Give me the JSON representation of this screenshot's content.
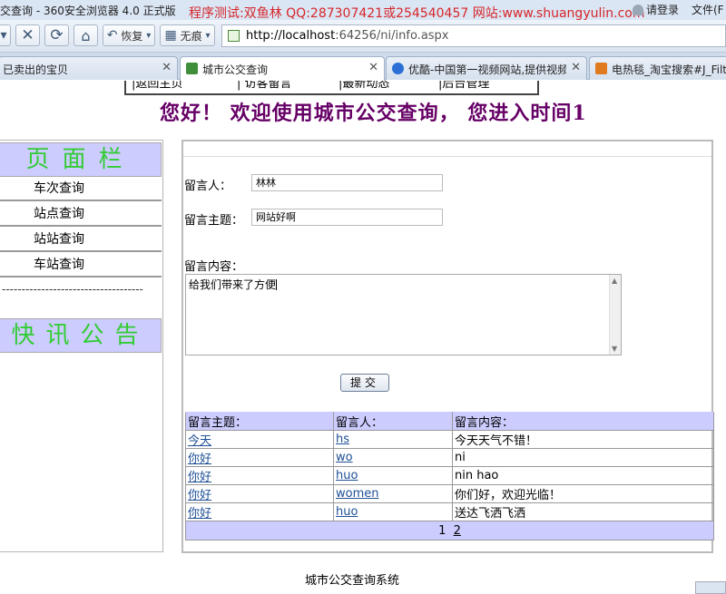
{
  "window": {
    "title": "交查询 - 360安全浏览器 4.0 正式版",
    "ad_text": "程序测试:双鱼林 QQ:287307421或254540457 网站:www.shuangyulin.com",
    "login": "请登录",
    "file_menu": "文件(F"
  },
  "toolbar": {
    "restore_label": "恢复",
    "incognito_label": "无痕",
    "url_host": "http://localhost",
    "url_path": ":64256/ni/info.aspx"
  },
  "tabs": [
    {
      "label": "已卖出的宝贝",
      "active": false,
      "icon_color": "#ffffff"
    },
    {
      "label": "城市公交查询",
      "active": true,
      "icon_color": "#3f8f3a"
    },
    {
      "label": "优酷-中国第一视频网站,提供视频...",
      "active": false,
      "icon_color": "#2b6fd6"
    },
    {
      "label": "电热毯_淘宝搜索#J_Filter",
      "active": false,
      "icon_color": "#e07a1f"
    }
  ],
  "page": {
    "topnav": [
      "|返回主页",
      "| 访客留言",
      "|最新动态",
      "|后台管理"
    ],
    "welcome": "您好！ 欢迎使用城市公交查询， 您进入时间1",
    "sidebar": {
      "heading": "页面栏",
      "items": [
        "车次查询",
        "站点查询",
        "站站查询",
        "车站查询"
      ],
      "divider": "------------------------------------",
      "notice_heading": "快讯公告"
    },
    "form": {
      "author_label": "留言人：",
      "author_value": "林林",
      "subject_label": "留言主题：",
      "subject_value": "网站好啊",
      "content_label": "留言内容：",
      "content_value": "给我们带来了方便",
      "submit_label": "提交"
    },
    "grid": {
      "headers": [
        "留言主题：",
        "留言人：",
        "留言内容："
      ],
      "rows": [
        {
          "subject": "今天",
          "author": "hs",
          "content": "今天天气不错！"
        },
        {
          "subject": "你好",
          "author": "wo",
          "content": "ni"
        },
        {
          "subject": "你好",
          "author": "huo",
          "content": "nin hao"
        },
        {
          "subject": "你好",
          "author": "women",
          "content": "你们好，欢迎光临！"
        },
        {
          "subject": "你好",
          "author": "huo",
          "content": "送达飞洒飞洒"
        }
      ],
      "pager": {
        "current": "1",
        "next": "2"
      }
    },
    "footer": "城市公交查询系统"
  },
  "colors": {
    "nav_bg": "#ccccff",
    "nav_text": "#33cc33",
    "welcome": "#660066",
    "link": "#1d4f96",
    "ad": "#d6262a"
  }
}
